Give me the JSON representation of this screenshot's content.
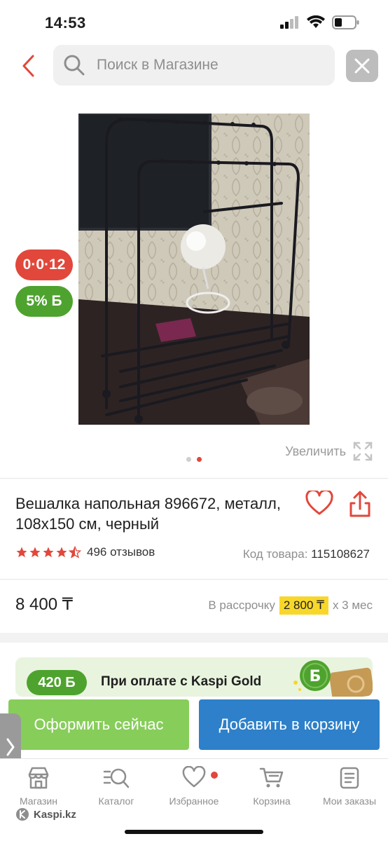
{
  "status_bar": {
    "time": "14:53"
  },
  "search": {
    "placeholder": "Поиск в Магазине"
  },
  "product": {
    "badge_installment": "0·0·12",
    "badge_bonus": "5% Б",
    "zoom_label": "Увеличить",
    "image_count": 2,
    "active_image": 2,
    "title": "Вешалка напольная 896672, металл, 108х150 см, черный",
    "rating": 4.5,
    "reviews": "496 отзывов",
    "sku_label": "Код товара:",
    "sku_value": "115108627",
    "price": "8 400 ₸",
    "installment_prefix": "В рассрочку",
    "installment_amount": "2 800 ₸",
    "installment_suffix": "х 3 мес"
  },
  "promo": {
    "bonus": "420 Б",
    "text": "При оплате с Kaspi Gold"
  },
  "actions": {
    "buy_now": "Оформить сейчас",
    "add_to_cart": "Добавить в корзину"
  },
  "nav": {
    "items": [
      {
        "label": "Магазин",
        "icon": "shop-icon"
      },
      {
        "label": "Каталог",
        "icon": "catalog-search-icon"
      },
      {
        "label": "Избранное",
        "icon": "heart-icon"
      },
      {
        "label": "Корзина",
        "icon": "cart-icon"
      },
      {
        "label": "Мои заказы",
        "icon": "orders-icon"
      }
    ]
  },
  "brand": "Kaspi.kz",
  "colors": {
    "accent_red": "#e2473b",
    "bonus_green": "#4ea32e",
    "buy_green": "#87cd5a",
    "cart_blue": "#2d80c9",
    "installment_yellow": "#f8d72b"
  }
}
